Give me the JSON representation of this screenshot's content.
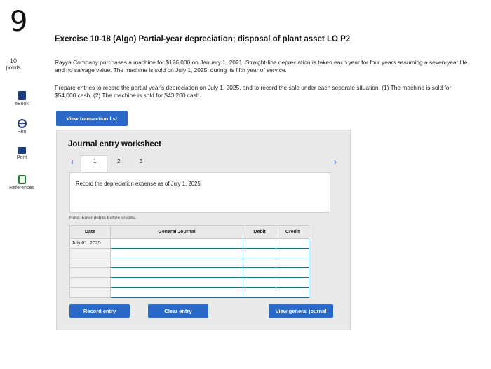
{
  "question": {
    "number": "9",
    "points_value": "10",
    "points_label": "points"
  },
  "sidebar": [
    {
      "label": "eBook",
      "icon": "book-icon"
    },
    {
      "label": "Hint",
      "icon": "hint-icon"
    },
    {
      "label": "Print",
      "icon": "print-icon"
    },
    {
      "label": "References",
      "icon": "references-icon"
    }
  ],
  "exercise": {
    "title": "Exercise 10-18 (Algo) Partial-year depreciation; disposal of plant asset LO P2",
    "paragraph1": "Rayya Company purchases a machine for $126,000 on January 1, 2021. Straight-line depreciation is taken each year for four years assuming a seven-year life and no salvage value. The machine is sold on July 1, 2025, during its fifth year of service.",
    "paragraph2": "Prepare entries to record the partial year's depreciation on July 1, 2025, and to record the sale under each separate situation. (1) The machine is sold for $54,000 cash. (2) The machine is sold for $43,200 cash."
  },
  "buttons": {
    "view_transaction_list": "View transaction list",
    "record_entry": "Record entry",
    "clear_entry": "Clear entry",
    "view_general_journal": "View general journal"
  },
  "worksheet": {
    "title": "Journal entry worksheet",
    "pages": [
      "1",
      "2",
      "3"
    ],
    "active_page": "1",
    "instruction": "Record the depreciation expense as of July 1, 2025.",
    "note": "Note: Enter debits before credits.",
    "columns": {
      "date": "Date",
      "general_journal": "General Journal",
      "debit": "Debit",
      "credit": "Credit"
    },
    "date_value": "July 01, 2025",
    "row_count": 6
  },
  "colors": {
    "accent": "#2a69c8",
    "panel_bg": "#e9e9e9",
    "input_border": "#1f6f94"
  }
}
